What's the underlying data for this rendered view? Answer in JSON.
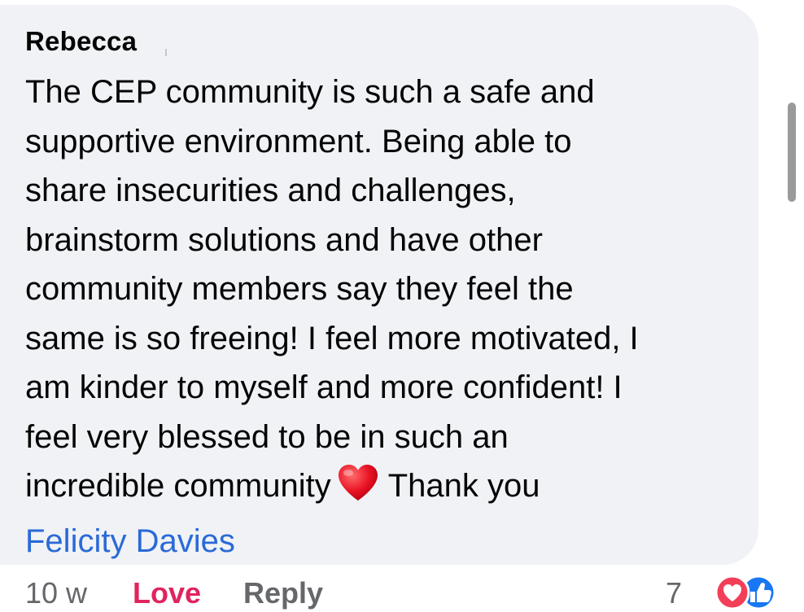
{
  "comment": {
    "author": "Rebecca",
    "lines": [
      "The CEP community is such a safe and",
      "supportive environment. Being able to",
      "share insecurities and challenges,",
      "brainstorm solutions and have other",
      "community members say they feel the",
      "same is so freeing! I feel more motivated, I",
      "am kinder to myself and more confident! I",
      "feel very blessed to be in such an"
    ],
    "last_line_before_emoji": "incredible community",
    "emoji_icon": "red-heart-icon",
    "last_line_after_emoji": "Thank you",
    "mention": "Felicity Davies"
  },
  "actions": {
    "timestamp": "10 w",
    "love_label": "Love",
    "reply_label": "Reply"
  },
  "reactions": {
    "count": "7",
    "icons": [
      "love-reaction-icon",
      "like-reaction-icon"
    ]
  },
  "colors": {
    "bubble": "#f0f2f5",
    "text": "#050505",
    "mention": "#2a6ad8",
    "love": "#e0245e",
    "secondary": "#65676b",
    "like": "#1877f2"
  }
}
